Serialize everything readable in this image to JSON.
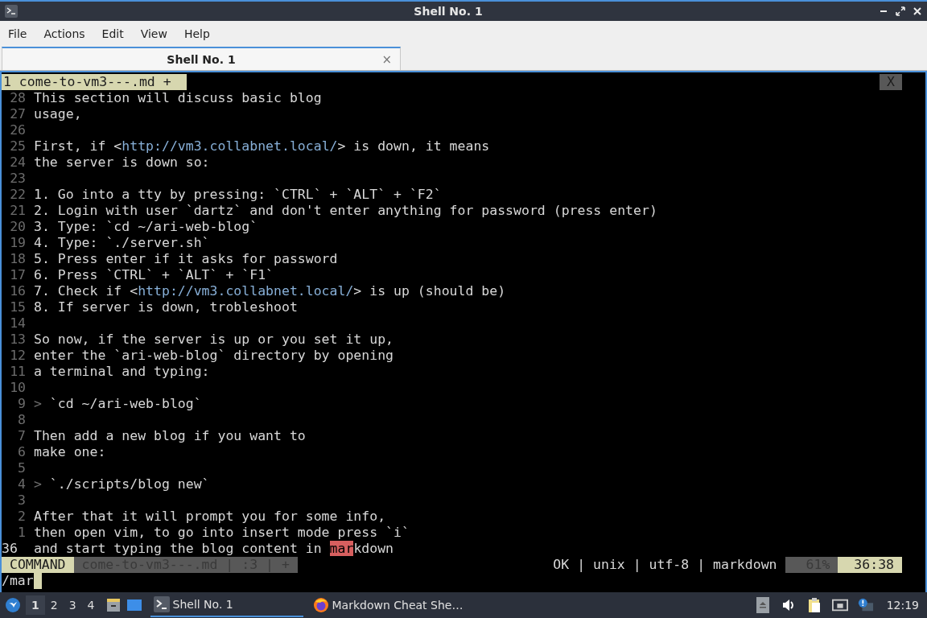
{
  "window": {
    "title": "Shell No. 1"
  },
  "menu": [
    "File",
    "Actions",
    "Edit",
    "View",
    "Help"
  ],
  "tabs": [
    {
      "label": "Shell No. 1",
      "selected": true,
      "close": "×"
    }
  ],
  "vim": {
    "tabline": {
      "label": "1 come-to-vm3---.md +",
      "close": "X"
    },
    "lines": [
      {
        "number": "28",
        "current": false,
        "segments": [
          {
            "text": "This section will discuss basic blog",
            "kind": "plain"
          }
        ]
      },
      {
        "number": "27",
        "current": false,
        "segments": [
          {
            "text": "usage,",
            "kind": "plain"
          }
        ]
      },
      {
        "number": "26",
        "current": false
      },
      {
        "number": "25",
        "current": false,
        "segments": [
          {
            "text": "First, if <",
            "kind": "plain"
          },
          {
            "text": "http://vm3.collabnet.local/",
            "kind": "url"
          },
          {
            "text": "> is down, it means",
            "kind": "plain"
          }
        ]
      },
      {
        "number": "24",
        "current": false,
        "segments": [
          {
            "text": "the server is down so:",
            "kind": "plain"
          }
        ]
      },
      {
        "number": "23",
        "current": false
      },
      {
        "number": "22",
        "current": false,
        "segments": [
          {
            "text": "1. Go into a tty by pressing: `CTRL` + `ALT` + `F2`",
            "kind": "plain"
          }
        ]
      },
      {
        "number": "21",
        "current": false,
        "segments": [
          {
            "text": "2. Login with user `dartz` and don't enter anything for password (press enter)",
            "kind": "plain"
          }
        ]
      },
      {
        "number": "20",
        "current": false,
        "segments": [
          {
            "text": "3. Type: `cd ~/ari-web-blog`",
            "kind": "plain"
          }
        ]
      },
      {
        "number": "19",
        "current": false,
        "segments": [
          {
            "text": "4. Type: `./server.sh`",
            "kind": "plain"
          }
        ]
      },
      {
        "number": "18",
        "current": false,
        "segments": [
          {
            "text": "5. Press enter if it asks for password",
            "kind": "plain"
          }
        ]
      },
      {
        "number": "17",
        "current": false,
        "segments": [
          {
            "text": "6. Press `CTRL` + `ALT` + `F1`",
            "kind": "plain"
          }
        ]
      },
      {
        "number": "16",
        "current": false,
        "segments": [
          {
            "text": "7. Check if <",
            "kind": "plain"
          },
          {
            "text": "http://vm3.collabnet.local/",
            "kind": "url"
          },
          {
            "text": "> is up (should be)",
            "kind": "plain"
          }
        ]
      },
      {
        "number": "15",
        "current": false,
        "segments": [
          {
            "text": "8. If server is down, trobleshoot",
            "kind": "plain"
          }
        ]
      },
      {
        "number": "14",
        "current": false
      },
      {
        "number": "13",
        "current": false,
        "segments": [
          {
            "text": "So now, if the server is up or you set it up,",
            "kind": "plain"
          }
        ]
      },
      {
        "number": "12",
        "current": false,
        "segments": [
          {
            "text": "enter the `ari-web-blog` directory by opening",
            "kind": "plain"
          }
        ]
      },
      {
        "number": "11",
        "current": false,
        "segments": [
          {
            "text": "a terminal and typing:",
            "kind": "plain"
          }
        ]
      },
      {
        "number": "10",
        "current": false
      },
      {
        "number": "9",
        "current": false,
        "segments": [
          {
            "text": ">",
            "kind": "quote"
          },
          {
            "text": " `cd ~/ari-web-blog`",
            "kind": "plain"
          }
        ]
      },
      {
        "number": "8",
        "current": false
      },
      {
        "number": "7",
        "current": false,
        "segments": [
          {
            "text": "Then add a new blog if you want to",
            "kind": "plain"
          }
        ]
      },
      {
        "number": "6",
        "current": false,
        "segments": [
          {
            "text": "make one:",
            "kind": "plain"
          }
        ]
      },
      {
        "number": "5",
        "current": false
      },
      {
        "number": "4",
        "current": false,
        "segments": [
          {
            "text": ">",
            "kind": "quote"
          },
          {
            "text": " `./scripts/blog new`",
            "kind": "plain"
          }
        ]
      },
      {
        "number": "3",
        "current": false
      },
      {
        "number": "2",
        "current": false,
        "segments": [
          {
            "text": "After that it will prompt you for some info,",
            "kind": "plain"
          }
        ]
      },
      {
        "number": "1",
        "current": false,
        "segments": [
          {
            "text": "then open vim, to go into insert mode press `i`",
            "kind": "plain"
          }
        ]
      },
      {
        "number": "36",
        "current": true,
        "segments": [
          {
            "text": "and start typing the blog content in ",
            "kind": "plain"
          },
          {
            "text": "mar",
            "kind": "match"
          },
          {
            "text": "kdown",
            "kind": "plain"
          }
        ]
      }
    ],
    "statusline": {
      "mode": "COMMAND",
      "file_info": "come-to-vm3---.md | :3 | +",
      "file_details": "OK | unix | utf-8 | markdown",
      "percent": "61%",
      "position": "36:38"
    },
    "cmdline": "/mar"
  },
  "taskbar": {
    "workspaces": [
      {
        "label": "1",
        "selected": true
      },
      {
        "label": "2",
        "selected": false
      },
      {
        "label": "3",
        "selected": false
      },
      {
        "label": "4",
        "selected": false
      }
    ],
    "tasks": [
      {
        "label": "Shell No. 1",
        "selected": true,
        "kind": "terminal"
      },
      {
        "label": "Markdown Cheat She…",
        "selected": false,
        "kind": "browser"
      }
    ],
    "clock": "12:19"
  }
}
